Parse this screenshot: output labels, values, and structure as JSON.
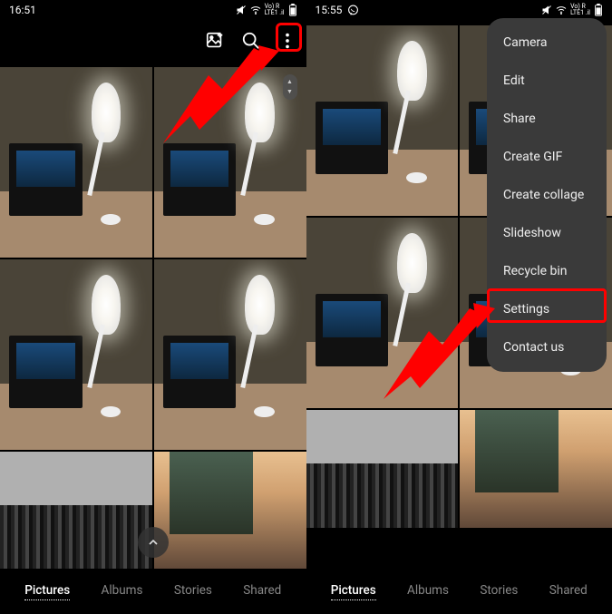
{
  "left": {
    "status": {
      "time": "16:51",
      "network_label": "Vo) R\nLTE1 .il"
    },
    "toolbar": {
      "create_icon": "create-icon",
      "search_icon": "search-icon",
      "more_icon": "more-icon"
    },
    "bottom_nav": {
      "items": [
        {
          "label": "Pictures",
          "active": true
        },
        {
          "label": "Albums",
          "active": false
        },
        {
          "label": "Stories",
          "active": false
        },
        {
          "label": "Shared",
          "active": false
        }
      ]
    },
    "scroll_pill": {
      "up": "▲",
      "down": "▼"
    },
    "fab_up": "⌃"
  },
  "right": {
    "status": {
      "time": "15:55",
      "network_label": "Vo) R\nLTE1 .il"
    },
    "menu": {
      "items": [
        "Camera",
        "Edit",
        "Share",
        "Create GIF",
        "Create collage",
        "Slideshow",
        "Recycle bin",
        "Settings",
        "Contact us"
      ]
    },
    "bottom_nav": {
      "items": [
        {
          "label": "Pictures",
          "active": true
        },
        {
          "label": "Albums",
          "active": false
        },
        {
          "label": "Stories",
          "active": false
        },
        {
          "label": "Shared",
          "active": false
        }
      ]
    }
  },
  "annotations": {
    "highlight_color": "#ff0000",
    "left_highlight_target": "more-options-button",
    "right_highlight_target": "menu-item-settings"
  }
}
